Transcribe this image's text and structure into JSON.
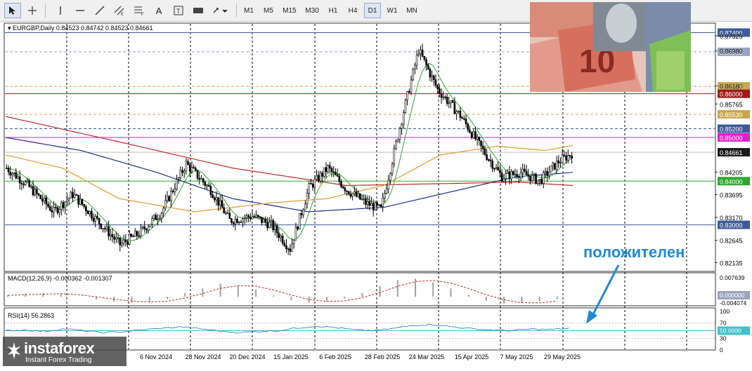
{
  "toolbar": {
    "timeframes": [
      "M1",
      "M5",
      "M15",
      "M30",
      "H1",
      "H4",
      "D1",
      "W1",
      "MN"
    ],
    "active_timeframe": "D1"
  },
  "chart_header": {
    "symbol_text": "EURGBP,Daily",
    "ohlc_text": "0.84523 0.84742 0.84523 0.84661"
  },
  "price_axis": {
    "ticks": [
      "0.87325",
      "0.86980",
      "0.86180",
      "0.85765",
      "0.84205",
      "0.83695",
      "0.83170",
      "0.82645",
      "0.82135"
    ],
    "level_labels": [
      {
        "value": 0.874,
        "text": "0.87400",
        "bg": "#3d5a99",
        "line": "#3d5a99",
        "style": "solid"
      },
      {
        "value": 0.8696,
        "text": "0.86960",
        "bg": "#9aa4c0",
        "line": "#9aa4c0",
        "style": "dash"
      },
      {
        "value": 0.8617,
        "text": "0.86174",
        "bg": "#c9a84c",
        "line": "#c9a84c",
        "style": "dash"
      },
      {
        "value": 0.86,
        "text": "0.86000",
        "bg": "#a01a1a",
        "line": "#a01a1a",
        "style": "solid"
      },
      {
        "value": 0.8553,
        "text": "0.85530",
        "bg": "#c9a84c",
        "line": "#c9a84c",
        "style": "dash"
      },
      {
        "value": 0.852,
        "text": "0.85200",
        "bg": "#3d5a99",
        "line": "#3d5a99",
        "style": "dash"
      },
      {
        "value": 0.85,
        "text": "0.85000",
        "bg": "#e020d0",
        "line": "#e020d0",
        "style": "solid"
      },
      {
        "value": 0.84661,
        "text": "0.84661",
        "bg": "#1a1a1a",
        "line": "#bbbbbb",
        "style": "solid"
      },
      {
        "value": 0.84,
        "text": "0.84000",
        "bg": "#2ea82e",
        "line": "#2ea82e",
        "style": "solid"
      },
      {
        "value": 0.83,
        "text": "0.83000",
        "bg": "#3d5a99",
        "line": "#3d5a99",
        "style": "solid"
      }
    ]
  },
  "date_axis": [
    "6 Nov 2024",
    "28 Nov 2024",
    "20 Dec 2024",
    "15 Jan 2025",
    "6 Feb 2025",
    "28 Feb 2025",
    "24 Mar 2025",
    "15 Apr 2025",
    "7 May 2025",
    "29 May 2025"
  ],
  "macd": {
    "label": "MACD(12,26,9) -0.000362 -0.001307",
    "ticks": [
      "0.007639",
      "0.000000",
      "-0.004074"
    ]
  },
  "rsi": {
    "label": "RSI(14) 56.2863",
    "ticks": [
      "100",
      "70",
      "50.0000",
      "30",
      "0"
    ]
  },
  "annotation": {
    "text": "положителен",
    "color": "#1e8ad6"
  },
  "logo": {
    "name": "instaforex",
    "tagline": "Instant Forex Trading"
  },
  "photo": {
    "banknote_label": "10"
  },
  "chart_data": {
    "type": "candlestick",
    "title": "EURGBP,Daily",
    "ylim": [
      0.8195,
      0.876
    ],
    "trend": [
      [
        0,
        0.843
      ],
      [
        10,
        0.8395
      ],
      [
        25,
        0.833
      ],
      [
        35,
        0.837
      ],
      [
        48,
        0.831
      ],
      [
        60,
        0.8255
      ],
      [
        70,
        0.828
      ],
      [
        82,
        0.833
      ],
      [
        95,
        0.844
      ],
      [
        108,
        0.838
      ],
      [
        118,
        0.831
      ],
      [
        130,
        0.832
      ],
      [
        140,
        0.83
      ],
      [
        150,
        0.8245
      ],
      [
        160,
        0.8385
      ],
      [
        170,
        0.843
      ],
      [
        180,
        0.838
      ],
      [
        190,
        0.835
      ],
      [
        198,
        0.8335
      ],
      [
        210,
        0.856
      ],
      [
        218,
        0.87
      ],
      [
        228,
        0.861
      ],
      [
        240,
        0.855
      ],
      [
        252,
        0.847
      ],
      [
        262,
        0.841
      ],
      [
        272,
        0.842
      ],
      [
        282,
        0.84
      ],
      [
        292,
        0.8445
      ],
      [
        300,
        0.8466
      ]
    ],
    "ma_slow_red": [
      [
        0,
        0.8548
      ],
      [
        60,
        0.849
      ],
      [
        120,
        0.843
      ],
      [
        180,
        0.839
      ],
      [
        240,
        0.8395
      ],
      [
        270,
        0.8398
      ],
      [
        300,
        0.839
      ]
    ],
    "ma_blue": [
      [
        0,
        0.85
      ],
      [
        40,
        0.847
      ],
      [
        80,
        0.842
      ],
      [
        120,
        0.836
      ],
      [
        160,
        0.833
      ],
      [
        200,
        0.834
      ],
      [
        240,
        0.838
      ],
      [
        270,
        0.841
      ],
      [
        300,
        0.842
      ]
    ],
    "ma_orange": [
      [
        0,
        0.846
      ],
      [
        30,
        0.843
      ],
      [
        60,
        0.836
      ],
      [
        100,
        0.833
      ],
      [
        140,
        0.835
      ],
      [
        170,
        0.836
      ],
      [
        200,
        0.839
      ],
      [
        230,
        0.846
      ],
      [
        260,
        0.848
      ],
      [
        285,
        0.847
      ],
      [
        300,
        0.8482
      ]
    ],
    "rsi_series": [
      50,
      52,
      48,
      55,
      50,
      45,
      47,
      52,
      56,
      60,
      55,
      49,
      45,
      48,
      50,
      57,
      62,
      58,
      52,
      50,
      56,
      64,
      66,
      60,
      55,
      52,
      50,
      54,
      53,
      56
    ],
    "macd_hist": [
      0.0005,
      0.0012,
      0.0015,
      0.001,
      0.0,
      -0.0012,
      -0.002,
      -0.0025,
      -0.0022,
      -0.001,
      0.0015,
      0.0035,
      0.0055,
      0.0048,
      0.003,
      0.0005,
      -0.0015,
      -0.0025,
      -0.002,
      -0.0008,
      0.0015,
      0.0045,
      0.007,
      0.0075,
      0.006,
      0.0035,
      0.0008,
      -0.0018,
      -0.003,
      -0.0028,
      -0.002,
      -0.001
    ]
  }
}
